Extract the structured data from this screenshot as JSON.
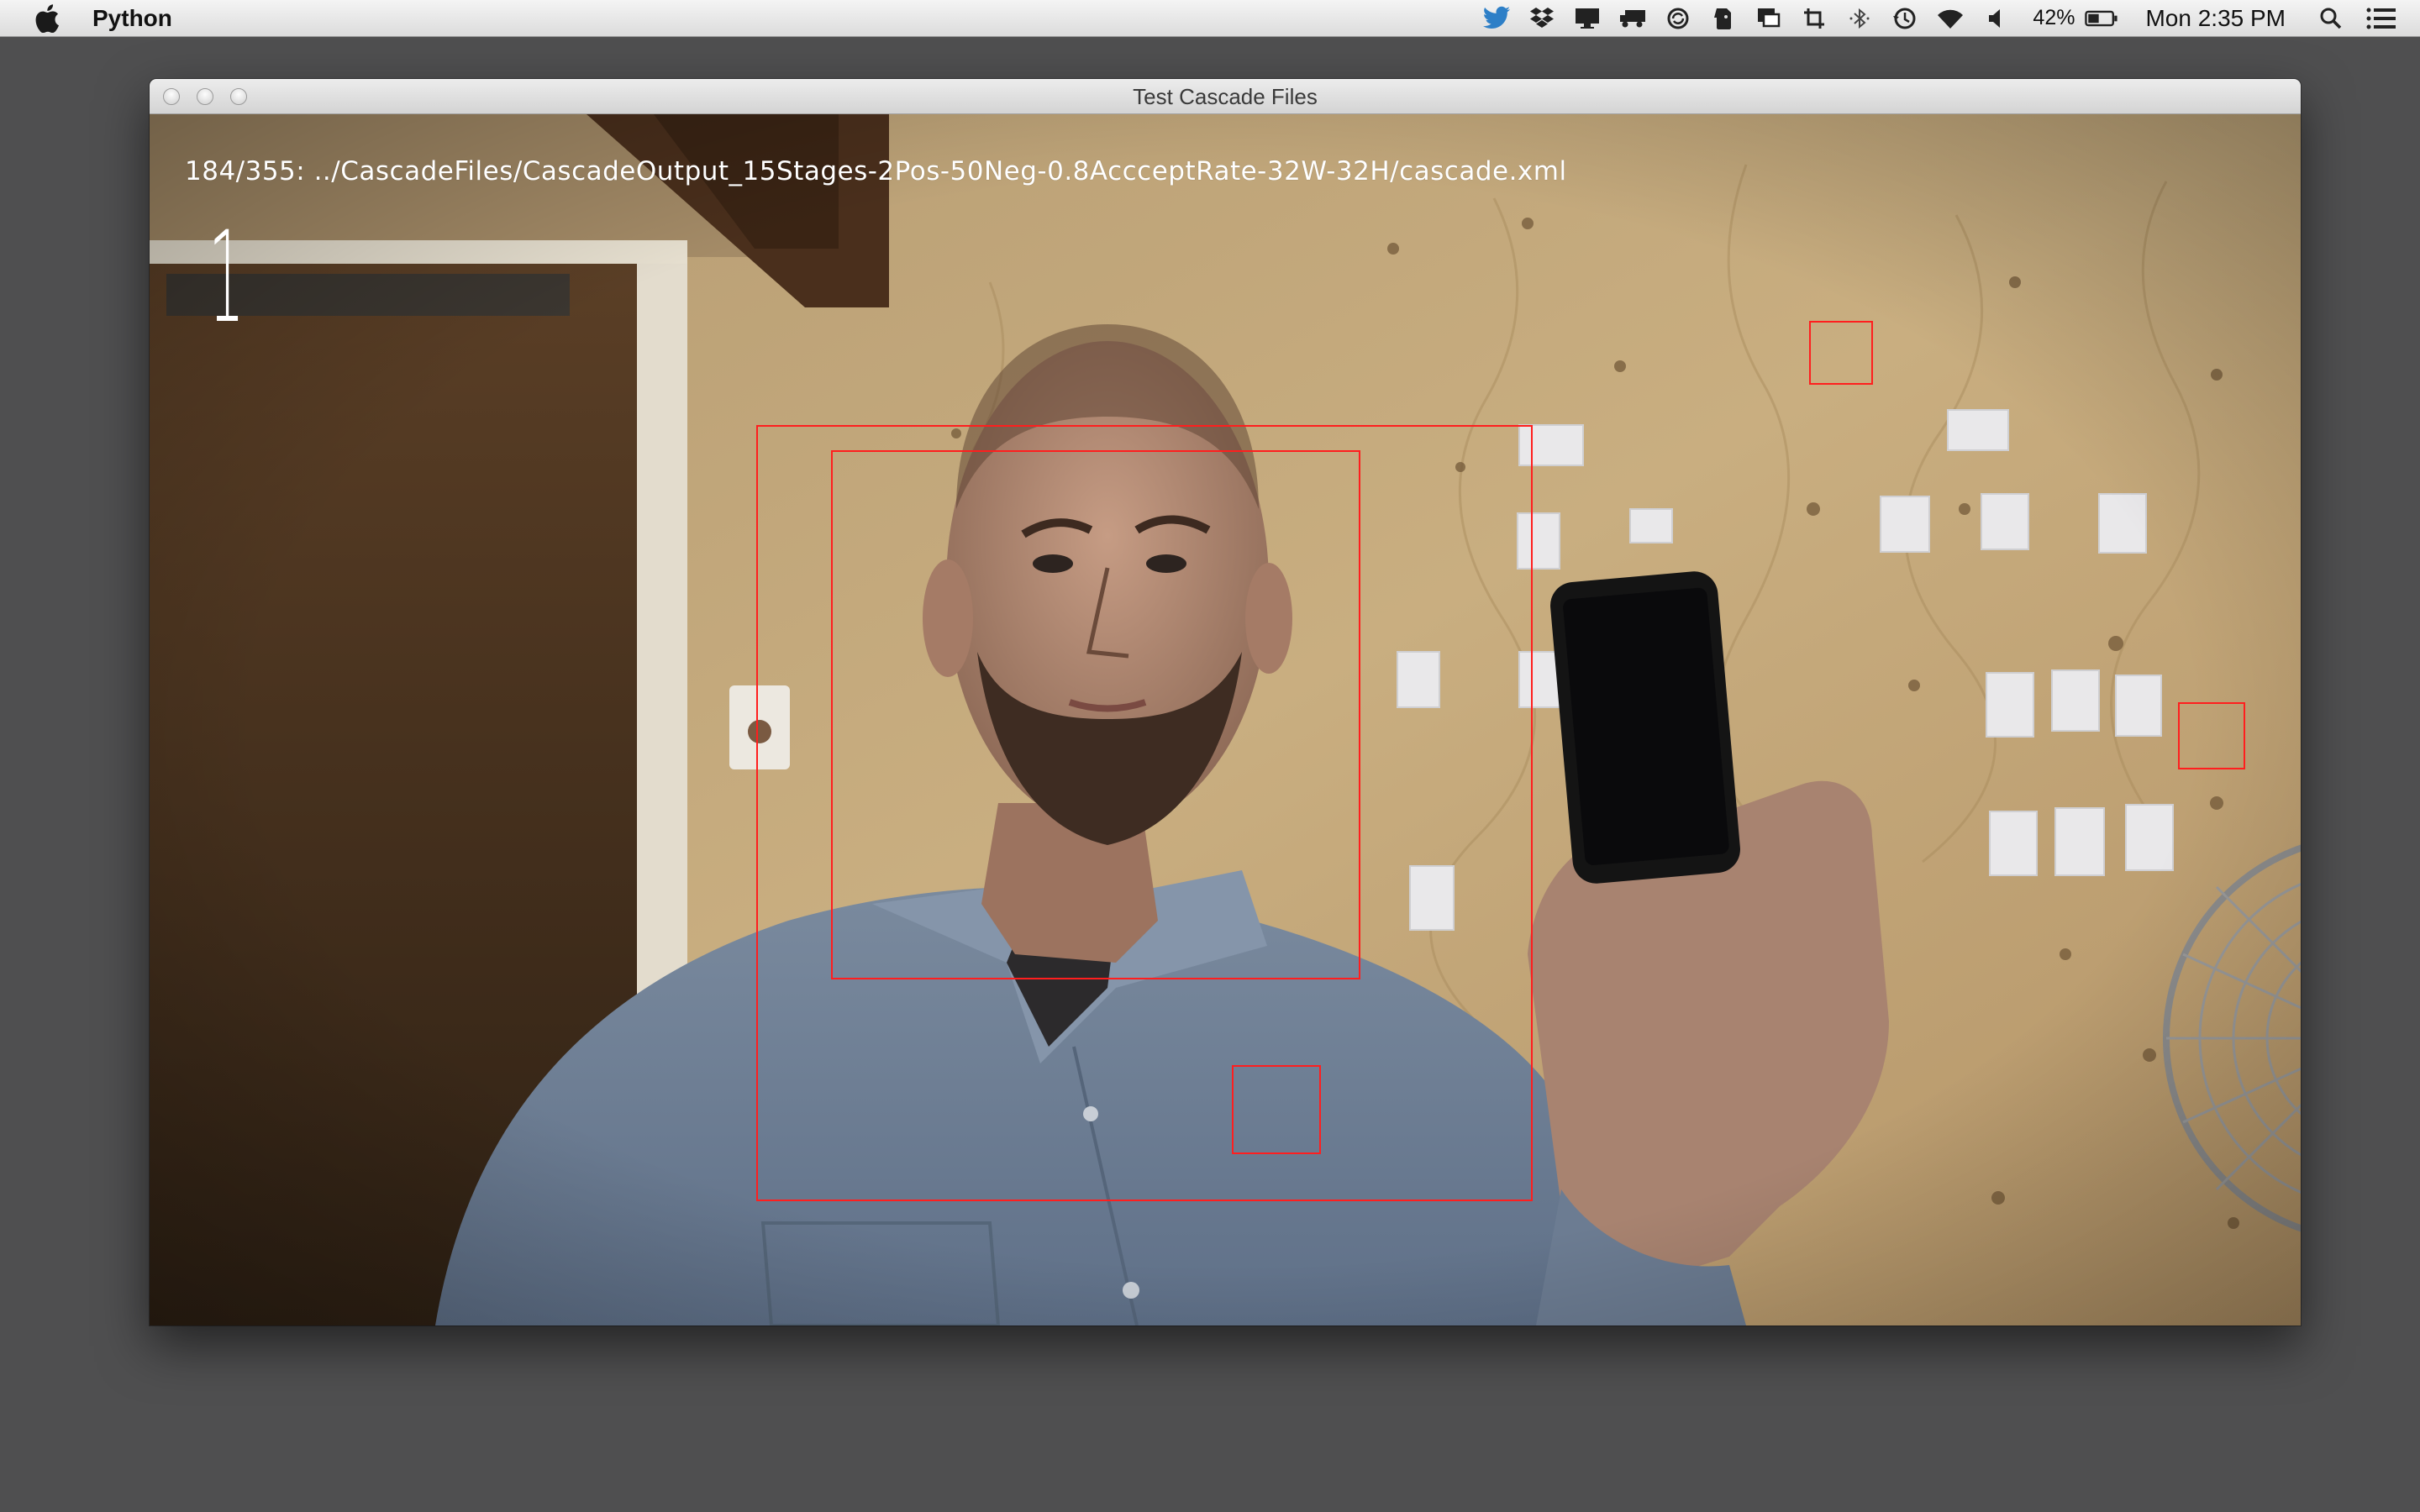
{
  "menubar": {
    "app_name": "Python",
    "battery_percent": "42%",
    "clock": "Mon 2:35 PM",
    "status_icons": [
      "twitter-icon",
      "dropbox-icon",
      "display-icon",
      "truck-icon",
      "sync-icon",
      "evernote-icon",
      "screen-share-icon",
      "crop-icon",
      "bluetooth-icon",
      "time-machine-icon",
      "wifi-icon",
      "volume-icon"
    ]
  },
  "window": {
    "title": "Test Cascade Files"
  },
  "camera": {
    "overlay_text": "184/355: ../CascadeFiles/CascadeOutput_15Stages-2Pos-50Neg-0.8AccceptRate-32W-32H/cascade.xml",
    "overlay_count": "1",
    "detection_color": "#ff1e1e",
    "detection_count": 5
  }
}
